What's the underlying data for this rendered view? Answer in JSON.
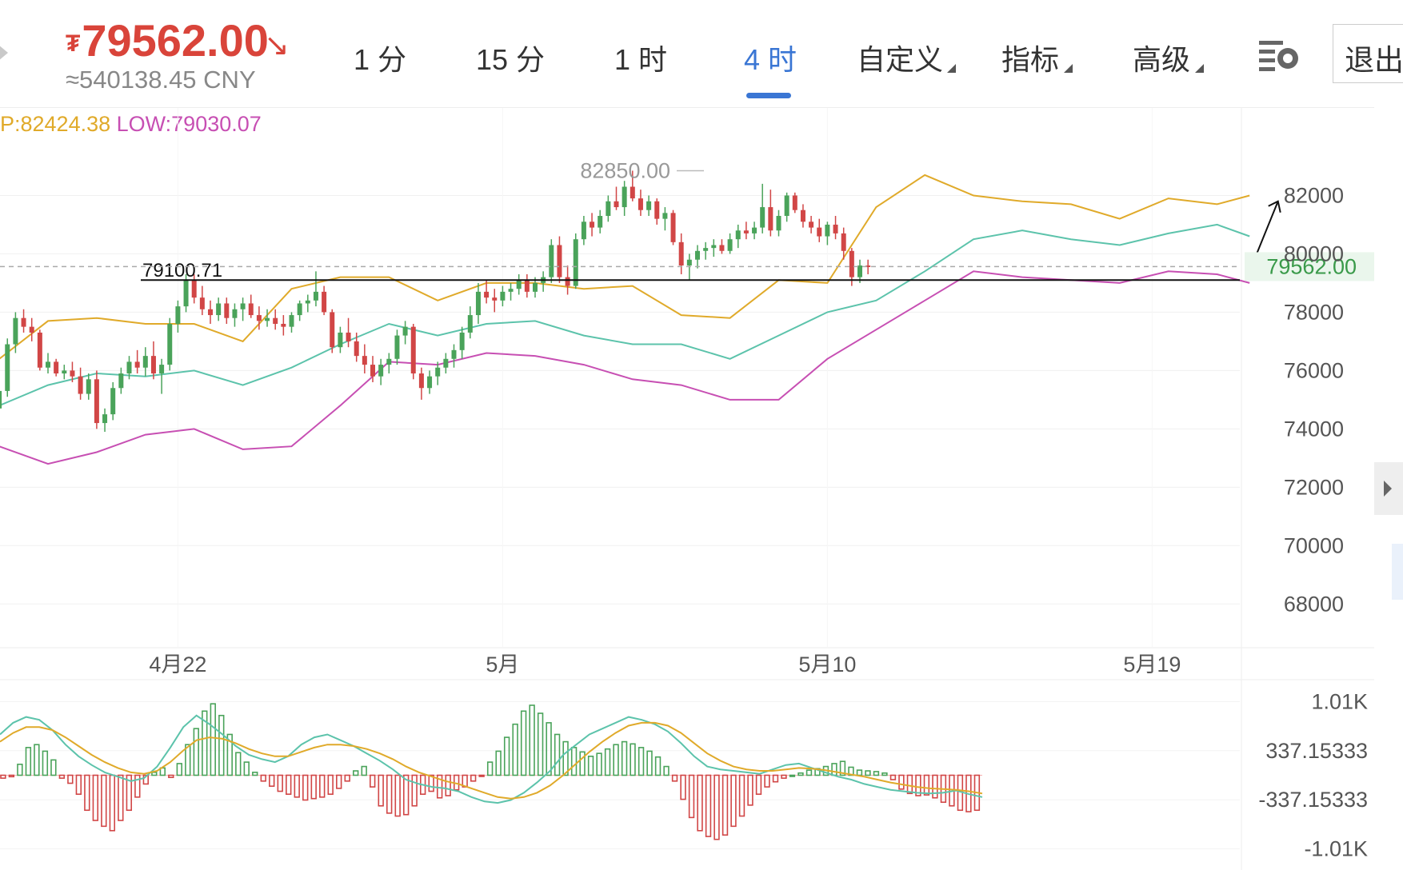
{
  "header": {
    "currency_symbol": "₮",
    "price": "79562.00",
    "trend_icon": "arrow-down-right-icon",
    "cny_equiv": "≈540138.45 CNY"
  },
  "tabs": [
    {
      "label": "1 分",
      "active": false,
      "has_menu": false
    },
    {
      "label": "15 分",
      "active": false,
      "has_menu": false
    },
    {
      "label": "1 时",
      "active": false,
      "has_menu": false
    },
    {
      "label": "4 时",
      "active": true,
      "has_menu": false
    },
    {
      "label": "自定义",
      "active": false,
      "has_menu": true
    },
    {
      "label": "指标",
      "active": false,
      "has_menu": true
    },
    {
      "label": "高级",
      "active": false,
      "has_menu": true
    }
  ],
  "settings_icon": "settings-gear-icon",
  "exit_button": "退出",
  "high_low": {
    "high": "P:82424.38",
    "low": "LOW:79030.07"
  },
  "colors": {
    "up": "#4aa35a",
    "down": "#d14646",
    "upper_band": "#e0aa2a",
    "mid_band": "#5cc3ab",
    "lower_band": "#c74fb3",
    "active_tab": "#3a76d4",
    "price": "#d9443a"
  },
  "chart_data": [
    {
      "type": "candlestick",
      "indicator": "Bollinger Bands",
      "current_price": "79562.00",
      "current_price_line": 79562,
      "annotations": [
        {
          "label": "82850.00",
          "value": 82850,
          "kind": "max-marker"
        },
        {
          "label": "79100.71",
          "value": 79100.71,
          "kind": "drawn-horizontal-line"
        },
        {
          "label": "",
          "kind": "drawn-arrow-up"
        }
      ],
      "y_ticks": [
        "82000",
        "80000",
        "78000",
        "76000",
        "74000",
        "72000",
        "70000",
        "68000"
      ],
      "y_tick_values": [
        82000,
        80000,
        78000,
        76000,
        74000,
        72000,
        70000,
        68000
      ],
      "ylim": [
        66500,
        85000
      ],
      "x_ticks": [
        "4月22",
        "5月",
        "5月10",
        "5月19"
      ],
      "x_tick_index": [
        36,
        76,
        116,
        156
      ],
      "x_range": [
        14,
        168
      ],
      "grid": true,
      "ohlc": [
        [
          74700,
          75400,
          74500,
          75300
        ],
        [
          75300,
          77100,
          75100,
          76900
        ],
        [
          76900,
          78000,
          76600,
          77800
        ],
        [
          77800,
          78100,
          77300,
          77500
        ],
        [
          77500,
          77800,
          77000,
          77300
        ],
        [
          77300,
          77400,
          76000,
          76100
        ],
        [
          76100,
          76600,
          75900,
          76300
        ],
        [
          76300,
          76400,
          75800,
          75900
        ],
        [
          75900,
          76200,
          75700,
          76000
        ],
        [
          76000,
          76300,
          75600,
          75800
        ],
        [
          75800,
          76100,
          75000,
          75200
        ],
        [
          75200,
          75900,
          75000,
          75700
        ],
        [
          75700,
          76000,
          74000,
          74200
        ],
        [
          74200,
          74700,
          73900,
          74500
        ],
        [
          74500,
          75600,
          74300,
          75400
        ],
        [
          75400,
          76100,
          75200,
          75900
        ],
        [
          75900,
          76500,
          75700,
          76300
        ],
        [
          76300,
          76700,
          75900,
          76100
        ],
        [
          76100,
          76800,
          75800,
          76500
        ],
        [
          76500,
          77000,
          75700,
          75900
        ],
        [
          75900,
          76400,
          75200,
          76200
        ],
        [
          76200,
          77800,
          76000,
          77600
        ],
        [
          77600,
          78400,
          77300,
          78200
        ],
        [
          78200,
          79300,
          78000,
          79100
        ],
        [
          79100,
          79300,
          78300,
          78500
        ],
        [
          78500,
          78900,
          77900,
          78100
        ],
        [
          78100,
          78400,
          77600,
          77900
        ],
        [
          77900,
          78500,
          77700,
          78300
        ],
        [
          78300,
          78500,
          77600,
          77800
        ],
        [
          77800,
          78300,
          77500,
          78100
        ],
        [
          78100,
          78500,
          77700,
          78300
        ],
        [
          78300,
          78600,
          77800,
          77900
        ],
        [
          77900,
          78200,
          77400,
          77700
        ],
        [
          77700,
          78100,
          77500,
          77800
        ],
        [
          77800,
          78100,
          77400,
          77600
        ],
        [
          77600,
          77900,
          77200,
          77500
        ],
        [
          77500,
          78000,
          77300,
          77900
        ],
        [
          77900,
          78400,
          77700,
          78300
        ],
        [
          78300,
          78600,
          78000,
          78400
        ],
        [
          78400,
          79400,
          78200,
          78700
        ],
        [
          78700,
          78900,
          77900,
          78000
        ],
        [
          78000,
          78100,
          76600,
          76800
        ],
        [
          76800,
          77500,
          76600,
          77300
        ],
        [
          77300,
          77800,
          76800,
          77000
        ],
        [
          77000,
          77300,
          76300,
          76500
        ],
        [
          76500,
          76900,
          75900,
          76200
        ],
        [
          76200,
          76500,
          75600,
          75800
        ],
        [
          75800,
          76400,
          75500,
          76200
        ],
        [
          76200,
          76600,
          75900,
          76400
        ],
        [
          76400,
          77400,
          76200,
          77200
        ],
        [
          77200,
          77700,
          76900,
          77500
        ],
        [
          77500,
          77600,
          75700,
          75900
        ],
        [
          75900,
          76100,
          75000,
          75400
        ],
        [
          75400,
          76000,
          75200,
          75800
        ],
        [
          75800,
          76300,
          75500,
          76100
        ],
        [
          76100,
          76600,
          75900,
          76400
        ],
        [
          76400,
          76900,
          76100,
          76700
        ],
        [
          76700,
          77500,
          76400,
          77300
        ],
        [
          77300,
          78200,
          77100,
          77900
        ],
        [
          77900,
          79000,
          77600,
          78700
        ],
        [
          78700,
          79100,
          78300,
          78500
        ],
        [
          78500,
          78800,
          78000,
          78400
        ],
        [
          78400,
          78900,
          78200,
          78700
        ],
        [
          78700,
          79000,
          78400,
          78800
        ],
        [
          78800,
          79300,
          78600,
          79100
        ],
        [
          79100,
          79300,
          78500,
          78700
        ],
        [
          78700,
          79200,
          78500,
          79000
        ],
        [
          79000,
          79400,
          78700,
          79200
        ],
        [
          79200,
          80500,
          79000,
          80300
        ],
        [
          80300,
          80600,
          79000,
          79200
        ],
        [
          79200,
          79600,
          78600,
          78900
        ],
        [
          78900,
          80700,
          78800,
          80500
        ],
        [
          80500,
          81300,
          80300,
          81100
        ],
        [
          81100,
          81400,
          80600,
          80900
        ],
        [
          80900,
          81500,
          80700,
          81300
        ],
        [
          81300,
          82000,
          81100,
          81800
        ],
        [
          81800,
          82300,
          81500,
          81600
        ],
        [
          81600,
          82500,
          81300,
          82300
        ],
        [
          82300,
          82850,
          81800,
          81900
        ],
        [
          81900,
          82200,
          81300,
          81500
        ],
        [
          81500,
          82000,
          81300,
          81800
        ],
        [
          81800,
          81900,
          81000,
          81200
        ],
        [
          81200,
          81600,
          80800,
          81400
        ],
        [
          81400,
          81500,
          80300,
          80400
        ],
        [
          80400,
          80700,
          79300,
          79600
        ],
        [
          79600,
          80000,
          79100,
          79800
        ],
        [
          79800,
          80300,
          79500,
          80100
        ],
        [
          80100,
          80400,
          79800,
          80200
        ],
        [
          80200,
          80500,
          79900,
          80300
        ],
        [
          80300,
          80500,
          80000,
          80100
        ],
        [
          80100,
          80700,
          80000,
          80500
        ],
        [
          80500,
          81000,
          80200,
          80800
        ],
        [
          80800,
          81100,
          80500,
          80700
        ],
        [
          80700,
          81100,
          80500,
          80900
        ],
        [
          80900,
          82400,
          80700,
          81600
        ],
        [
          81600,
          82200,
          80600,
          80800
        ],
        [
          80800,
          81500,
          80600,
          81300
        ],
        [
          81300,
          82100,
          81100,
          82000
        ],
        [
          82000,
          82100,
          81400,
          81500
        ],
        [
          81500,
          81700,
          80900,
          81100
        ],
        [
          81100,
          81300,
          80700,
          80900
        ],
        [
          80900,
          81200,
          80400,
          80600
        ],
        [
          80600,
          81100,
          80300,
          81000
        ],
        [
          81000,
          81300,
          80500,
          80700
        ],
        [
          80700,
          80900,
          79800,
          80100
        ],
        [
          80100,
          80200,
          78900,
          79200
        ],
        [
          79200,
          79800,
          79000,
          79600
        ],
        [
          79600,
          79800,
          79300,
          79562
        ]
      ],
      "x": [
        14,
        15,
        16,
        17,
        18,
        19,
        20,
        21,
        22,
        23,
        24,
        25,
        26,
        27,
        28,
        29,
        30,
        31,
        32,
        33,
        34,
        35,
        36,
        37,
        38,
        39,
        40,
        41,
        42,
        43,
        44,
        45,
        46,
        47,
        48,
        49,
        50,
        51,
        52,
        53,
        54,
        55,
        56,
        57,
        58,
        59,
        60,
        61,
        62,
        63,
        64,
        65,
        66,
        67,
        68,
        69,
        70,
        71,
        72,
        73,
        74,
        75,
        76,
        77,
        78,
        79,
        80,
        81,
        82,
        83,
        84,
        85,
        86,
        87,
        88,
        89,
        90,
        91,
        92,
        93,
        94,
        95,
        96,
        97,
        98,
        99,
        100,
        101,
        102,
        103,
        104,
        105,
        106,
        107,
        108,
        109,
        110,
        111,
        112,
        113,
        114,
        115,
        116,
        117,
        118,
        119,
        120,
        121,
        122,
        123,
        124,
        125,
        126,
        127,
        128,
        129,
        130,
        131,
        132,
        133,
        134,
        135,
        136,
        137,
        138,
        139,
        140,
        141,
        142,
        143,
        144,
        145,
        146,
        147,
        148,
        149,
        150,
        151,
        152,
        153,
        154,
        155,
        156,
        157,
        158,
        159,
        160,
        161,
        162,
        163,
        164,
        165,
        166,
        167,
        168
      ],
      "bands": {
        "x": [
          14,
          20,
          26,
          32,
          38,
          44,
          50,
          56,
          62,
          68,
          74,
          80,
          86,
          92,
          98,
          104,
          110,
          116,
          122,
          128,
          134,
          140,
          146,
          152,
          158,
          164,
          168
        ],
        "upper": [
          76400,
          77700,
          77800,
          77600,
          77600,
          77000,
          78800,
          79200,
          79200,
          78400,
          79000,
          79000,
          78800,
          78900,
          77900,
          77800,
          79100,
          79000,
          81600,
          82700,
          82000,
          81800,
          81700,
          81200,
          81900,
          81700,
          82000
        ],
        "middle": [
          74800,
          75500,
          75900,
          75800,
          76000,
          75500,
          76100,
          76900,
          77600,
          77200,
          77600,
          77700,
          77200,
          76900,
          76900,
          76400,
          77200,
          78000,
          78400,
          79400,
          80500,
          80800,
          80500,
          80300,
          80700,
          81000,
          80600
        ],
        "lower": [
          73400,
          72800,
          73200,
          73800,
          74000,
          73300,
          73400,
          74800,
          76300,
          76200,
          76600,
          76500,
          76200,
          75700,
          75500,
          75000,
          75000,
          76400,
          77400,
          78400,
          79400,
          79200,
          79100,
          79000,
          79400,
          79300,
          79000
        ]
      }
    },
    {
      "type": "bar",
      "indicator": "MACD",
      "y_ticks": [
        "1.01K",
        "337.15333",
        "-337.15333",
        "-1.01K"
      ],
      "y_tick_values": [
        1010,
        337.15333,
        -337.15333,
        -1010
      ],
      "ylim": [
        -1300,
        1300
      ],
      "histogram": [
        -40,
        -20,
        150,
        380,
        420,
        330,
        210,
        -40,
        -110,
        -260,
        -480,
        -620,
        -700,
        -760,
        -620,
        -480,
        -300,
        -120,
        40,
        100,
        -30,
        160,
        420,
        640,
        880,
        980,
        820,
        560,
        310,
        180,
        40,
        -80,
        -150,
        -220,
        -260,
        -300,
        -340,
        -320,
        -300,
        -260,
        -180,
        -80,
        60,
        120,
        -160,
        -420,
        -520,
        -560,
        -540,
        -420,
        -260,
        -220,
        -310,
        -280,
        -200,
        -160,
        -80,
        -10,
        180,
        330,
        520,
        700,
        880,
        960,
        850,
        720,
        560,
        460,
        380,
        320,
        260,
        300,
        360,
        420,
        460,
        430,
        380,
        330,
        250,
        120,
        -80,
        -330,
        -580,
        -760,
        -840,
        -880,
        -820,
        -700,
        -560,
        -410,
        -260,
        -160,
        -90,
        -40,
        0,
        30,
        70,
        90,
        120,
        160,
        190,
        110,
        70,
        60,
        50,
        30,
        -60,
        -190,
        -250,
        -280,
        -270,
        -310,
        -370,
        -420,
        -480,
        -500,
        -480
      ],
      "dif": [
        560,
        720,
        800,
        760,
        620,
        420,
        260,
        140,
        40,
        -20,
        -80,
        -40,
        120,
        380,
        660,
        820,
        700,
        560,
        400,
        280,
        220,
        180,
        260,
        420,
        520,
        560,
        480,
        400,
        300,
        200,
        80,
        -60,
        -120,
        -160,
        -180,
        -220,
        -300,
        -360,
        -380,
        -340,
        -240,
        -100,
        60,
        280,
        420,
        560,
        640,
        720,
        800,
        760,
        700,
        600,
        440,
        260,
        120,
        80,
        60,
        40,
        20,
        80,
        140,
        160,
        100,
        40,
        -20,
        -60,
        -120,
        -160,
        -200,
        -220,
        -240,
        -250,
        -240,
        -210,
        -260,
        -300
      ],
      "dea": [
        460,
        580,
        660,
        660,
        620,
        520,
        400,
        280,
        180,
        100,
        40,
        20,
        60,
        180,
        340,
        480,
        520,
        500,
        440,
        360,
        300,
        260,
        260,
        320,
        380,
        420,
        420,
        400,
        360,
        300,
        220,
        120,
        40,
        -20,
        -80,
        -120,
        -180,
        -240,
        -300,
        -320,
        -300,
        -240,
        -140,
        0,
        160,
        320,
        460,
        580,
        680,
        720,
        720,
        680,
        580,
        440,
        300,
        200,
        120,
        80,
        60,
        60,
        80,
        100,
        90,
        70,
        40,
        10,
        -20,
        -60,
        -100,
        -130,
        -160,
        -180,
        -190,
        -200,
        -220,
        -250
      ]
    }
  ]
}
